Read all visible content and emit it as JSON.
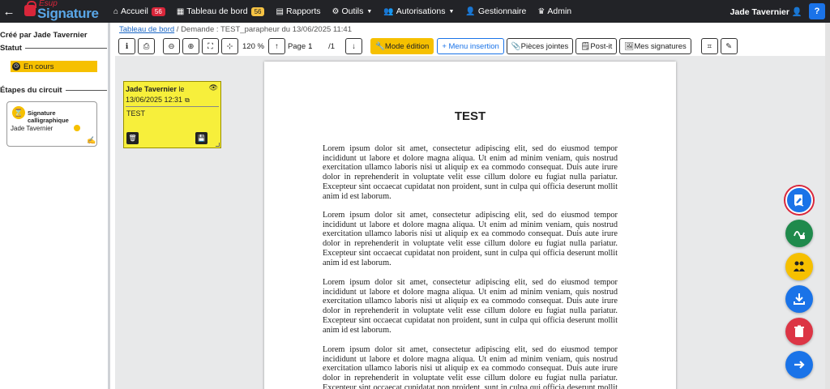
{
  "navbar": {
    "back_icon": "arrow-left-icon",
    "logo": {
      "top": "Esup",
      "main": "Signature"
    },
    "items": [
      {
        "label": "Accueil",
        "icon": "home-icon",
        "badge": "56",
        "badge_color": "#d9263a"
      },
      {
        "label": "Tableau de bord",
        "icon": "dashboard-icon",
        "badge": "56",
        "badge_color": "#f6c344"
      },
      {
        "label": "Rapports",
        "icon": "report-icon"
      },
      {
        "label": "Outils",
        "icon": "tools-icon",
        "dropdown": true
      },
      {
        "label": "Autorisations",
        "icon": "users-icon",
        "dropdown": true
      },
      {
        "label": "Gestionnaire",
        "icon": "user-icon"
      },
      {
        "label": "Admin",
        "icon": "crown-icon"
      }
    ],
    "user": "Jade Tavernier",
    "help_label": "?"
  },
  "sidebar": {
    "created_by": "Créé par Jade Tavernier",
    "status_title": "Statut",
    "status_value": "En cours",
    "steps_title": "Étapes du circuit",
    "step": {
      "name": "Signature calligraphique",
      "user": "Jade Tavernier"
    }
  },
  "breadcrumb": {
    "root": "Tableau de bord",
    "separator": "/",
    "current": "Demande : TEST_parapheur du 13/06/2025 11:41"
  },
  "toolbar": {
    "zoom": "120 %",
    "page_label": "Page",
    "page_value": "1",
    "page_total": "/1",
    "mode_edition": "Mode édition",
    "menu_insertion": "+ Menu insertion",
    "pieces_jointes": "Pièces jointes",
    "postit": "Post-it",
    "mes_signatures": "Mes signatures"
  },
  "postit": {
    "author": "Jade Tavernier",
    "le": "le",
    "date": "13/06/2025 12:31",
    "text": "TEST"
  },
  "document": {
    "title": "TEST",
    "paragraphs": [
      "Lorem ipsum dolor sit amet, consectetur adipiscing elit, sed do eiusmod tempor incididunt ut labore et dolore magna aliqua. Ut enim ad minim veniam, quis nostrud exercitation ullamco laboris nisi ut aliquip ex ea commodo consequat. Duis aute irure dolor in reprehenderit in voluptate velit esse cillum dolore eu fugiat nulla pariatur. Excepteur sint occaecat cupidatat non proident, sunt in culpa qui officia deserunt mollit anim id est laborum.",
      "Lorem ipsum dolor sit amet, consectetur adipiscing elit, sed do eiusmod tempor incididunt ut labore et dolore magna aliqua. Ut enim ad minim veniam, quis nostrud exercitation ullamco laboris nisi ut aliquip ex ea commodo consequat. Duis aute irure dolor in reprehenderit in voluptate velit esse cillum dolore eu fugiat nulla pariatur. Excepteur sint occaecat cupidatat non proident, sunt in culpa qui officia deserunt mollit anim id est laborum.",
      "Lorem ipsum dolor sit amet, consectetur adipiscing elit, sed do eiusmod tempor incididunt ut labore et dolore magna aliqua. Ut enim ad minim veniam, quis nostrud exercitation ullamco laboris nisi ut aliquip ex ea commodo consequat. Duis aute irure dolor in reprehenderit in voluptate velit esse cillum dolore eu fugiat nulla pariatur. Excepteur sint occaecat cupidatat non proident, sunt in culpa qui officia deserunt mollit anim id est laborum.",
      "Lorem ipsum dolor sit amet, consectetur adipiscing elit, sed do eiusmod tempor incididunt ut labore et dolore magna aliqua. Ut enim ad minim veniam, quis nostrud exercitation ullamco laboris nisi ut aliquip ex ea commodo consequat. Duis aute irure dolor in reprehenderit in voluptate velit esse cillum dolore eu fugiat nulla pariatur. Excepteur sint occaecat cupidatat non proident, sunt in culpa qui officia deserunt mollit anim id est laborum."
    ]
  },
  "fabs": [
    {
      "name": "sign-fab",
      "icon": "signature-icon",
      "color": "#1a73e8"
    },
    {
      "name": "sign-pdf-fab",
      "icon": "pdf-sign-icon",
      "color": "#1f8a4c"
    },
    {
      "name": "transfer-fab",
      "icon": "users-icon",
      "color": "#f6c000"
    },
    {
      "name": "download-fab",
      "icon": "download-icon",
      "color": "#1a73e8"
    },
    {
      "name": "delete-fab",
      "icon": "trash-icon",
      "color": "#dc3545"
    },
    {
      "name": "next-fab",
      "icon": "arrow-right-icon",
      "color": "#1a73e8"
    }
  ]
}
